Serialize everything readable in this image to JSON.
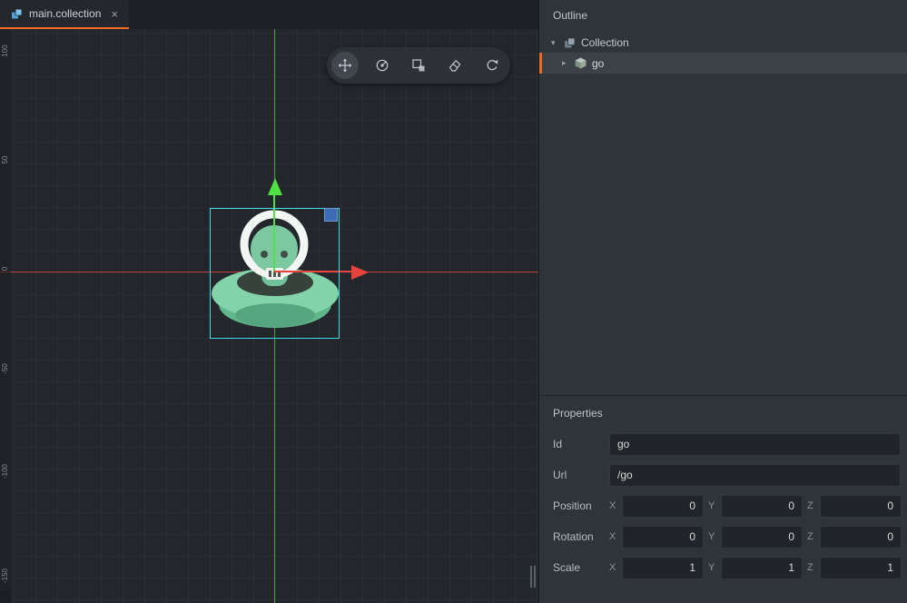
{
  "tab_bar": {
    "tabs": [
      {
        "label": "main.collection",
        "close_icon": "×"
      }
    ]
  },
  "icons": {
    "caret_down": "▾",
    "caret_right": "▸"
  },
  "outline": {
    "title": "Outline",
    "items": [
      {
        "label": "Collection",
        "type": "collection",
        "expanded": true
      },
      {
        "label": "go",
        "type": "game-object",
        "selected": true
      }
    ]
  },
  "properties": {
    "title": "Properties",
    "axis": {
      "x": "X",
      "y": "Y",
      "z": "Z"
    },
    "rows": [
      {
        "label": "Id",
        "value": "go"
      },
      {
        "label": "Url",
        "value": "/go"
      },
      {
        "label": "Position",
        "x": "0",
        "y": "0",
        "z": "0"
      },
      {
        "label": "Rotation",
        "x": "0",
        "y": "0",
        "z": "0"
      },
      {
        "label": "Scale",
        "x": "1",
        "y": "1",
        "z": "1"
      }
    ]
  },
  "viewport": {
    "ruler": [
      "100",
      "50",
      "0",
      "-50",
      "-100",
      "-150"
    ],
    "toolbar": [
      "move",
      "rotate",
      "scale",
      "eraser",
      "refresh"
    ]
  },
  "colors": {
    "accent_orange": "#f36d21",
    "selection_cyan": "#3ce1e6",
    "axis_x_red": "#d84040",
    "axis_y_green": "#46c83e"
  }
}
